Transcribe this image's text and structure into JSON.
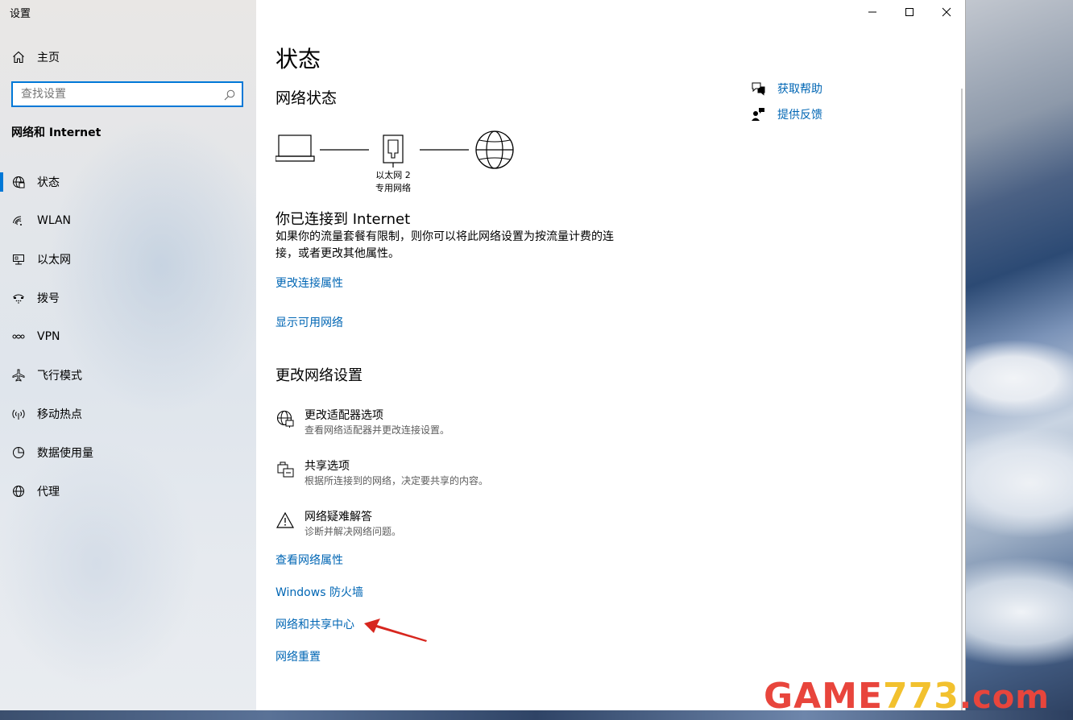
{
  "window": {
    "title": "设置"
  },
  "sidebar": {
    "home_label": "主页",
    "search_placeholder": "查找设置",
    "section_title": "网络和 Internet",
    "items": [
      {
        "label": "状态",
        "icon": "globe-status-icon",
        "active": true
      },
      {
        "label": "WLAN",
        "icon": "wifi-icon"
      },
      {
        "label": "以太网",
        "icon": "ethernet-icon"
      },
      {
        "label": "拨号",
        "icon": "dialup-icon"
      },
      {
        "label": "VPN",
        "icon": "vpn-icon"
      },
      {
        "label": "飞行模式",
        "icon": "airplane-icon"
      },
      {
        "label": "移动热点",
        "icon": "hotspot-icon"
      },
      {
        "label": "数据使用量",
        "icon": "data-usage-icon"
      },
      {
        "label": "代理",
        "icon": "proxy-globe-icon"
      }
    ]
  },
  "main": {
    "page_title": "状态",
    "network_status_heading": "网络状态",
    "adapter_name": "以太网 2",
    "network_type": "专用网络",
    "connected_heading": "你已连接到 Internet",
    "connected_desc": "如果你的流量套餐有限制，则你可以将此网络设置为按流量计费的连接，或者更改其他属性。",
    "link_change_props": "更改连接属性",
    "link_show_networks": "显示可用网络",
    "change_settings_heading": "更改网络设置",
    "settings": [
      {
        "title": "更改适配器选项",
        "desc": "查看网络适配器并更改连接设置。",
        "icon": "adapter-globe-icon"
      },
      {
        "title": "共享选项",
        "desc": "根据所连接到的网络，决定要共享的内容。",
        "icon": "sharing-icon"
      },
      {
        "title": "网络疑难解答",
        "desc": "诊断并解决网络问题。",
        "icon": "warning-icon"
      }
    ],
    "link_view_props": "查看网络属性",
    "link_firewall": "Windows 防火墙",
    "link_sharing_center": "网络和共享中心",
    "link_reset": "网络重置"
  },
  "related": {
    "get_help": "获取帮助",
    "feedback": "提供反馈"
  },
  "watermark": {
    "part1": "GAME",
    "part2": "773",
    "part3": ".com"
  },
  "colors": {
    "accent": "#0078d7",
    "link": "#0066b4",
    "annotation_arrow": "#d7261e"
  }
}
